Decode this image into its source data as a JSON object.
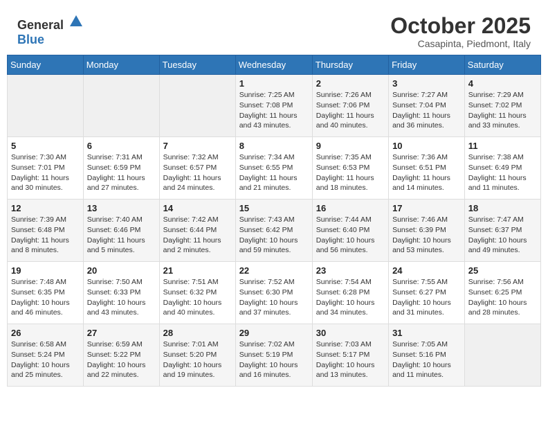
{
  "header": {
    "logo_general": "General",
    "logo_blue": "Blue",
    "month": "October 2025",
    "location": "Casapinta, Piedmont, Italy"
  },
  "days_of_week": [
    "Sunday",
    "Monday",
    "Tuesday",
    "Wednesday",
    "Thursday",
    "Friday",
    "Saturday"
  ],
  "weeks": [
    [
      {
        "day": "",
        "sunrise": "",
        "sunset": "",
        "daylight": ""
      },
      {
        "day": "",
        "sunrise": "",
        "sunset": "",
        "daylight": ""
      },
      {
        "day": "",
        "sunrise": "",
        "sunset": "",
        "daylight": ""
      },
      {
        "day": "1",
        "sunrise": "7:25 AM",
        "sunset": "7:08 PM",
        "daylight": "11 hours and 43 minutes."
      },
      {
        "day": "2",
        "sunrise": "7:26 AM",
        "sunset": "7:06 PM",
        "daylight": "11 hours and 40 minutes."
      },
      {
        "day": "3",
        "sunrise": "7:27 AM",
        "sunset": "7:04 PM",
        "daylight": "11 hours and 36 minutes."
      },
      {
        "day": "4",
        "sunrise": "7:29 AM",
        "sunset": "7:02 PM",
        "daylight": "11 hours and 33 minutes."
      }
    ],
    [
      {
        "day": "5",
        "sunrise": "7:30 AM",
        "sunset": "7:01 PM",
        "daylight": "11 hours and 30 minutes."
      },
      {
        "day": "6",
        "sunrise": "7:31 AM",
        "sunset": "6:59 PM",
        "daylight": "11 hours and 27 minutes."
      },
      {
        "day": "7",
        "sunrise": "7:32 AM",
        "sunset": "6:57 PM",
        "daylight": "11 hours and 24 minutes."
      },
      {
        "day": "8",
        "sunrise": "7:34 AM",
        "sunset": "6:55 PM",
        "daylight": "11 hours and 21 minutes."
      },
      {
        "day": "9",
        "sunrise": "7:35 AM",
        "sunset": "6:53 PM",
        "daylight": "11 hours and 18 minutes."
      },
      {
        "day": "10",
        "sunrise": "7:36 AM",
        "sunset": "6:51 PM",
        "daylight": "11 hours and 14 minutes."
      },
      {
        "day": "11",
        "sunrise": "7:38 AM",
        "sunset": "6:49 PM",
        "daylight": "11 hours and 11 minutes."
      }
    ],
    [
      {
        "day": "12",
        "sunrise": "7:39 AM",
        "sunset": "6:48 PM",
        "daylight": "11 hours and 8 minutes."
      },
      {
        "day": "13",
        "sunrise": "7:40 AM",
        "sunset": "6:46 PM",
        "daylight": "11 hours and 5 minutes."
      },
      {
        "day": "14",
        "sunrise": "7:42 AM",
        "sunset": "6:44 PM",
        "daylight": "11 hours and 2 minutes."
      },
      {
        "day": "15",
        "sunrise": "7:43 AM",
        "sunset": "6:42 PM",
        "daylight": "10 hours and 59 minutes."
      },
      {
        "day": "16",
        "sunrise": "7:44 AM",
        "sunset": "6:40 PM",
        "daylight": "10 hours and 56 minutes."
      },
      {
        "day": "17",
        "sunrise": "7:46 AM",
        "sunset": "6:39 PM",
        "daylight": "10 hours and 53 minutes."
      },
      {
        "day": "18",
        "sunrise": "7:47 AM",
        "sunset": "6:37 PM",
        "daylight": "10 hours and 49 minutes."
      }
    ],
    [
      {
        "day": "19",
        "sunrise": "7:48 AM",
        "sunset": "6:35 PM",
        "daylight": "10 hours and 46 minutes."
      },
      {
        "day": "20",
        "sunrise": "7:50 AM",
        "sunset": "6:33 PM",
        "daylight": "10 hours and 43 minutes."
      },
      {
        "day": "21",
        "sunrise": "7:51 AM",
        "sunset": "6:32 PM",
        "daylight": "10 hours and 40 minutes."
      },
      {
        "day": "22",
        "sunrise": "7:52 AM",
        "sunset": "6:30 PM",
        "daylight": "10 hours and 37 minutes."
      },
      {
        "day": "23",
        "sunrise": "7:54 AM",
        "sunset": "6:28 PM",
        "daylight": "10 hours and 34 minutes."
      },
      {
        "day": "24",
        "sunrise": "7:55 AM",
        "sunset": "6:27 PM",
        "daylight": "10 hours and 31 minutes."
      },
      {
        "day": "25",
        "sunrise": "7:56 AM",
        "sunset": "6:25 PM",
        "daylight": "10 hours and 28 minutes."
      }
    ],
    [
      {
        "day": "26",
        "sunrise": "6:58 AM",
        "sunset": "5:24 PM",
        "daylight": "10 hours and 25 minutes."
      },
      {
        "day": "27",
        "sunrise": "6:59 AM",
        "sunset": "5:22 PM",
        "daylight": "10 hours and 22 minutes."
      },
      {
        "day": "28",
        "sunrise": "7:01 AM",
        "sunset": "5:20 PM",
        "daylight": "10 hours and 19 minutes."
      },
      {
        "day": "29",
        "sunrise": "7:02 AM",
        "sunset": "5:19 PM",
        "daylight": "10 hours and 16 minutes."
      },
      {
        "day": "30",
        "sunrise": "7:03 AM",
        "sunset": "5:17 PM",
        "daylight": "10 hours and 13 minutes."
      },
      {
        "day": "31",
        "sunrise": "7:05 AM",
        "sunset": "5:16 PM",
        "daylight": "10 hours and 11 minutes."
      },
      {
        "day": "",
        "sunrise": "",
        "sunset": "",
        "daylight": ""
      }
    ]
  ],
  "labels": {
    "sunrise": "Sunrise:",
    "sunset": "Sunset:",
    "daylight": "Daylight:"
  }
}
